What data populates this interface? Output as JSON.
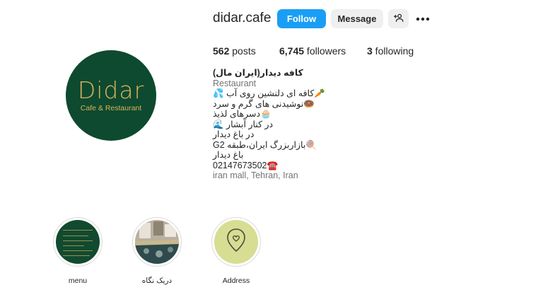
{
  "profile": {
    "username": "didar.cafe",
    "logo_text": "Didar",
    "logo_subtext": "Cafe & Restaurant"
  },
  "actions": {
    "follow_label": "Follow",
    "message_label": "Message",
    "suggest_icon": "add-user-icon",
    "more_icon": "more-dots-icon"
  },
  "stats": {
    "posts_count": "562",
    "posts_label": " posts",
    "followers_count": "6,745",
    "followers_label": " followers",
    "following_count": "3",
    "following_label": " following"
  },
  "bio": {
    "name": "کافه دیدار(ایران مال)",
    "category": "Restaurant",
    "lines": [
      "🥕کافه ای دلنشین روی آب 💦",
      "🍩نوشیدنی های گرم و سرد",
      "🧁دسرهای لذیذ",
      "در کنار آبشار 🌊",
      "در باغ دیدار",
      "🍭بازاربزرگ ایران،طبقه G2",
      "باغ دیدار"
    ],
    "phone": "02147673502☎️",
    "address": "iran mall, Tehran, Iran"
  },
  "highlights": [
    {
      "label": "menu"
    },
    {
      "label": "دریک نگاه"
    },
    {
      "label": "Address"
    }
  ],
  "colors": {
    "brand_green": "#0e4a2f",
    "brand_gold": "#d9b25c",
    "follow_blue": "#1a9ef5"
  }
}
